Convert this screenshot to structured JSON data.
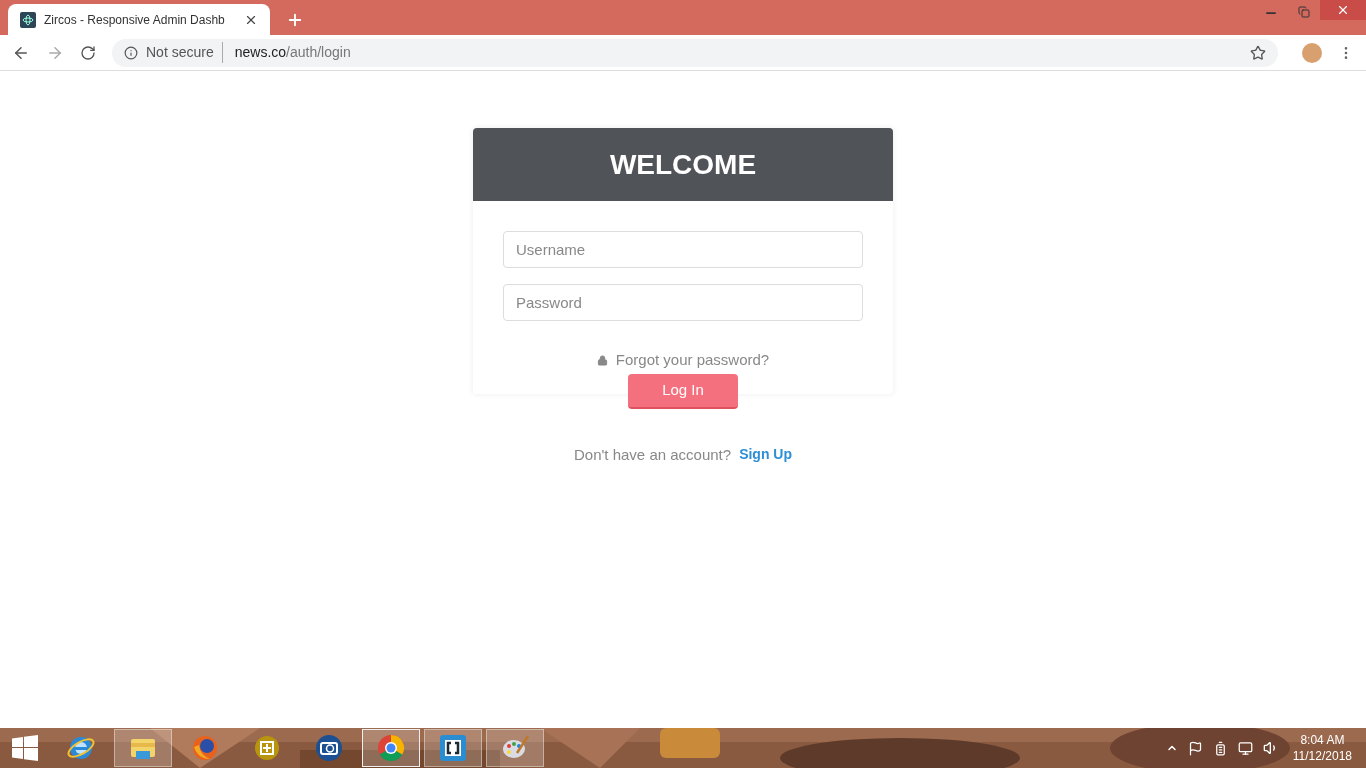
{
  "browser": {
    "tab": {
      "title": "Zircos - Responsive Admin Dashb",
      "selected": true
    },
    "security": "Not secure",
    "url_host": "news.co",
    "url_path": "/auth/login"
  },
  "login": {
    "title": "WELCOME",
    "username": {
      "placeholder": "Username"
    },
    "password": {
      "placeholder": "Password"
    },
    "forgot": "Forgot your password?",
    "button": "Log In",
    "signup_prompt": "Don't have an account?",
    "signup_link": "Sign Up"
  },
  "taskbar": {
    "apps": [
      {
        "kind": "ie",
        "open": false,
        "active": false
      },
      {
        "kind": "explorer",
        "open": true,
        "active": false
      },
      {
        "kind": "firefox",
        "open": false,
        "active": false
      },
      {
        "kind": "snip",
        "open": false,
        "active": false
      },
      {
        "kind": "camera",
        "open": false,
        "active": false
      },
      {
        "kind": "chrome",
        "open": true,
        "active": true
      },
      {
        "kind": "brackets",
        "open": true,
        "active": false
      },
      {
        "kind": "paint",
        "open": true,
        "active": false
      }
    ],
    "time": "8:04 AM",
    "date": "11/12/2018"
  }
}
